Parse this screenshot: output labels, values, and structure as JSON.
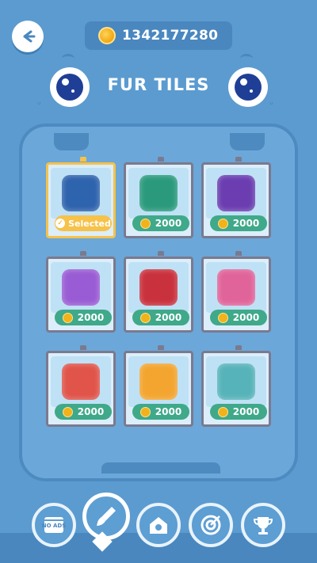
{
  "header": {
    "coins": "1342177280",
    "title": "FUR TILES"
  },
  "tiles": [
    {
      "color": "#2e63ad",
      "state": "Selected",
      "price": ""
    },
    {
      "color": "#2b9a7c",
      "state": "",
      "price": "2000"
    },
    {
      "color": "#6b3db0",
      "state": "",
      "price": "2000"
    },
    {
      "color": "#9a5cd4",
      "state": "",
      "price": "2000"
    },
    {
      "color": "#c9313d",
      "state": "",
      "price": "2000"
    },
    {
      "color": "#e0649a",
      "state": "",
      "price": "2000"
    },
    {
      "color": "#e0544a",
      "state": "",
      "price": "2000"
    },
    {
      "color": "#f3a530",
      "state": "",
      "price": "2000"
    },
    {
      "color": "#56b3b9",
      "state": "",
      "price": "2000"
    }
  ],
  "nav": {
    "items": [
      {
        "name": "no-ads",
        "label": "NO ADS"
      },
      {
        "name": "brush"
      },
      {
        "name": "home"
      },
      {
        "name": "target"
      },
      {
        "name": "trophy"
      }
    ]
  }
}
